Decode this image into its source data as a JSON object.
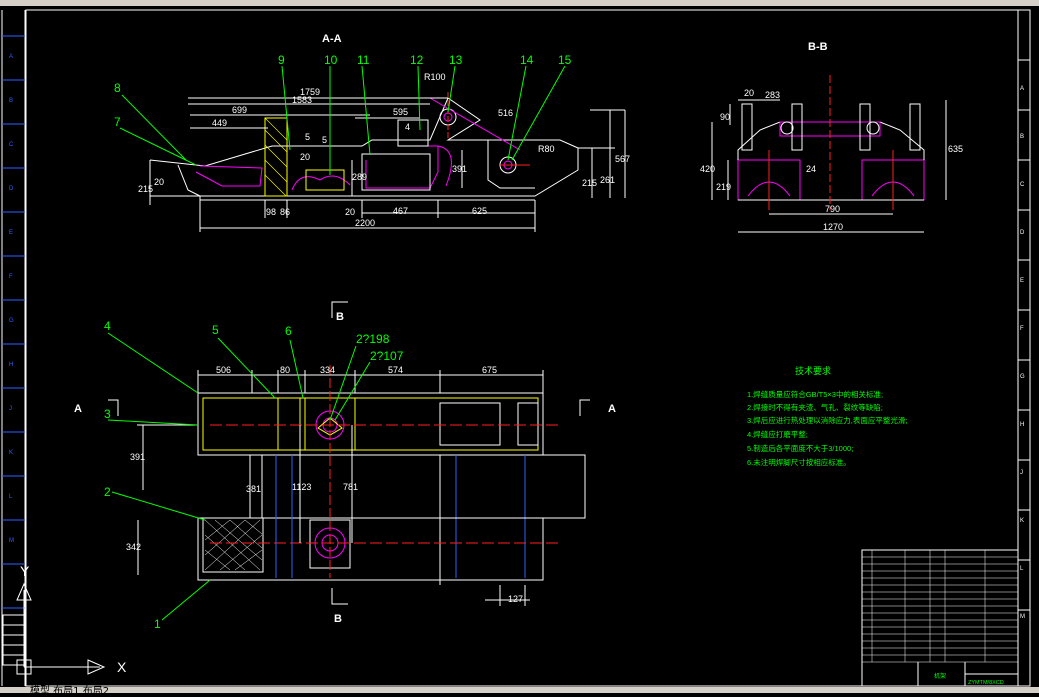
{
  "window": {
    "status_text": "模型  布局1  布局2"
  },
  "ucs": {
    "x_label": "X",
    "y_label": "Y"
  },
  "sections": {
    "aa_top": "A-A",
    "bb_top": "B-B",
    "b_upper": "B",
    "b_lower": "B",
    "a_left": "A",
    "a_right": "A"
  },
  "balloons": [
    "1",
    "2",
    "3",
    "4",
    "5",
    "6",
    "7",
    "8",
    "9",
    "10",
    "11",
    "12",
    "13",
    "14",
    "15"
  ],
  "aa_dims": {
    "d1759": "1759",
    "d1583": "1583",
    "d699": "699",
    "d449": "449",
    "d595": "595",
    "d215a": "215",
    "d20a": "20",
    "d98": "98",
    "d86": "86",
    "d20b": "20",
    "d467": "467",
    "d625": "625",
    "d2200": "2200",
    "d215b": "215",
    "d261": "261",
    "d567": "567",
    "d391": "391",
    "d289": "289",
    "d516": "516",
    "dR100": "R100",
    "dR80": "R80"
  },
  "weld_marks": {
    "w1": "5",
    "w2": "5",
    "w3": "20",
    "w4": "4"
  },
  "bb_dims": {
    "d20": "20",
    "d283": "283",
    "d90": "90",
    "d420": "420",
    "d219": "219",
    "d24": "24",
    "d790": "790",
    "d1270": "1270",
    "d635": "635"
  },
  "plan_dims": {
    "d506": "506",
    "d80": "80",
    "d334": "334",
    "d574": "574",
    "d675": "675",
    "d391": "391",
    "d381": "381",
    "d1123": "1123",
    "d781": "781",
    "d342": "342",
    "d127": "127",
    "d198": "2?198",
    "d107": "2?107"
  },
  "notes": {
    "title": "技术要求",
    "items": [
      "1.焊缝质量应符合GB/T5×3中的相关标准;",
      "2.焊接时不得有夹渣、气孔、裂纹等缺陷;",
      "3.焊后应进行热处理以消除应力,表面应平整光滑;",
      "4.焊缝应打磨平整;",
      "5.制造后各平面度不大于3/1000;",
      "6.未注明焊脚尺寸按相应标准。"
    ]
  },
  "title_block": {
    "drawing_no": "ZYMTM/8XCD",
    "name": "机架"
  },
  "ruler_left": [
    "A",
    "B",
    "C",
    "D",
    "E",
    "F",
    "G",
    "H",
    "J",
    "K",
    "L",
    "M"
  ],
  "ruler_right": [
    "A",
    "B",
    "C",
    "D",
    "E",
    "F",
    "G",
    "H",
    "J",
    "K",
    "L",
    "M"
  ]
}
